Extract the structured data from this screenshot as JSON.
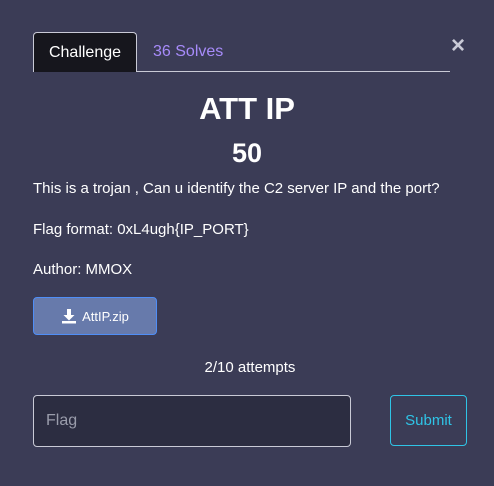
{
  "tabs": {
    "challenge_label": "Challenge",
    "solves_label": "36 Solves"
  },
  "close_icon": "×",
  "challenge": {
    "title": "ATT IP",
    "points": "50",
    "description": "This is a trojan , Can u identify the C2 server IP and the port?",
    "flag_format": "Flag format: 0xL4ugh{IP_PORT}",
    "author": "Author: MMOX"
  },
  "download": {
    "icon": "download-icon",
    "label": "AttIP.zip"
  },
  "attempts": "2/10 attempts",
  "flag_input": {
    "placeholder": "Flag",
    "value": ""
  },
  "submit_label": "Submit",
  "colors": {
    "background": "#3b3c56",
    "active_tab": "#16161d",
    "solves_link": "#a78bfa",
    "download_button": "#677aab",
    "submit_accent": "#2fc4e6"
  }
}
